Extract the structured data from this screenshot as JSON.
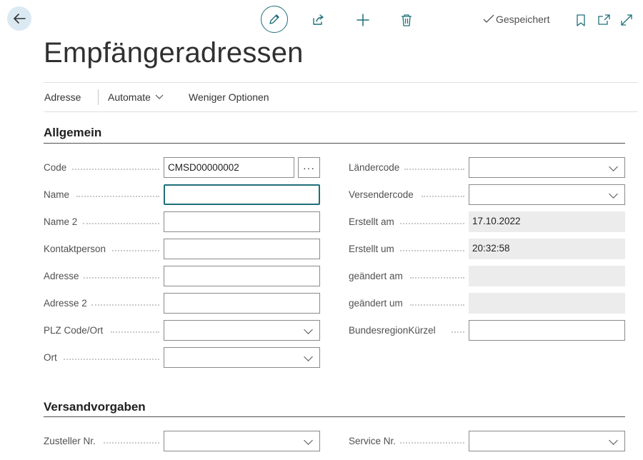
{
  "header": {
    "saved_label": "Gespeichert",
    "page_title": "Empfängeradressen"
  },
  "actions": {
    "adresse": "Adresse",
    "automate": "Automate",
    "weniger": "Weniger Optionen"
  },
  "sections": {
    "allgemein": "Allgemein",
    "versand": "Versandvorgaben"
  },
  "left_fields": [
    {
      "label": "Code",
      "value": "CMSD00000002"
    },
    {
      "label": "Name",
      "value": ""
    },
    {
      "label": "Name 2",
      "value": ""
    },
    {
      "label": "Kontaktperson",
      "value": ""
    },
    {
      "label": "Adresse",
      "value": ""
    },
    {
      "label": "Adresse 2",
      "value": ""
    },
    {
      "label": "PLZ Code/Ort",
      "value": ""
    },
    {
      "label": "Ort",
      "value": ""
    }
  ],
  "right_fields": [
    {
      "label": "Ländercode",
      "value": ""
    },
    {
      "label": "Versendercode",
      "value": ""
    },
    {
      "label": "Erstellt am",
      "value": "17.10.2022"
    },
    {
      "label": "Erstellt um",
      "value": "20:32:58"
    },
    {
      "label": "geändert am",
      "value": ""
    },
    {
      "label": "geändert um",
      "value": ""
    },
    {
      "label": "BundesregionKürzel",
      "value": ""
    }
  ],
  "versand_fields": [
    {
      "label": "Zusteller Nr.",
      "value": ""
    },
    {
      "label": "Service Nr.",
      "value": ""
    }
  ],
  "assist_label": "···"
}
